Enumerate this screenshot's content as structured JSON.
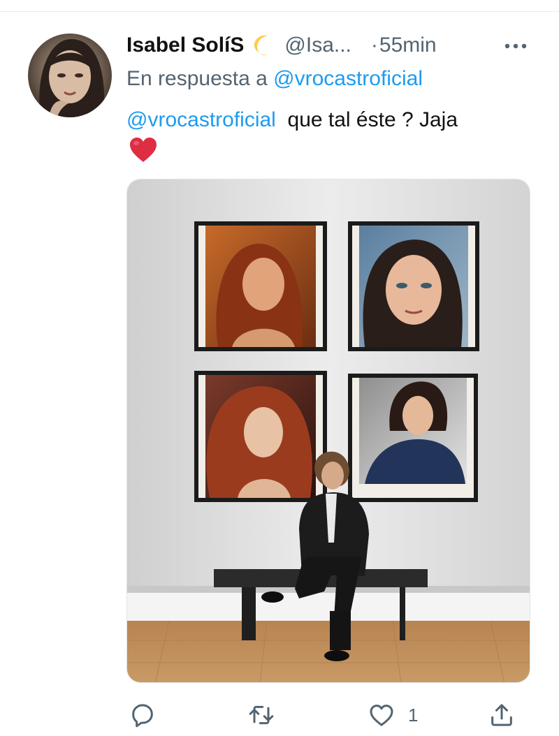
{
  "tweet": {
    "display_name": "Isabel SolíS",
    "handle": "@Isa...",
    "separator": "·",
    "time": "55min",
    "reply_prefix": "En respuesta a",
    "reply_to": "@vrocastroficial",
    "text_mention": "@vrocastroficial",
    "text_body": "que tal éste ? Jaja"
  },
  "actions": {
    "like_count": "1"
  },
  "icons": {
    "name_emoji": "crescent-moon-icon",
    "text_emoji": "red-heart-icon",
    "more": "more-icon",
    "reply": "reply-icon",
    "retweet": "retweet-icon",
    "like": "like-icon",
    "share": "share-icon"
  },
  "colors": {
    "link": "#1d9bf0",
    "secondary_text": "#536471",
    "primary_text": "#111111"
  }
}
